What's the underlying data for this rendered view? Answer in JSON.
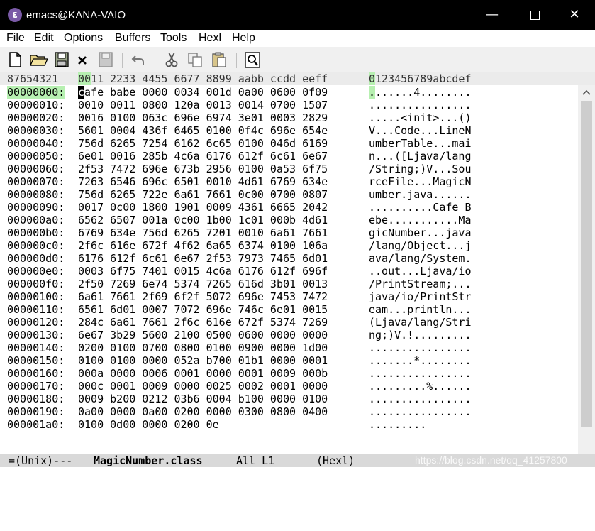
{
  "window": {
    "title": "emacs@KANA-VAIO",
    "app_icon": "emacs-icon"
  },
  "menubar": [
    "File",
    "Edit",
    "Options",
    "Buffers",
    "Tools",
    "Hexl",
    "Help"
  ],
  "toolbar": [
    "new-file-icon",
    "open-folder-icon",
    "save-disk-icon",
    "close-x-icon",
    "save-as-icon",
    "undo-icon",
    "cut-icon",
    "copy-icon",
    "paste-icon",
    "search-icon"
  ],
  "header": {
    "addr": "87654321",
    "hex_hl": "00",
    "hex_rest": "11 2233 4455 6677 8899 aabb ccdd eeff",
    "ascii_hl": "0",
    "ascii_rest": "123456789abcdef"
  },
  "cursor_row": {
    "addr": "00000000:",
    "hex_cursor": "c",
    "hex_rest": "afe babe 0000 0034 001d 0a00 0600 0f09",
    "ascii_hl": ".",
    "ascii_rest": "......4........"
  },
  "rows": [
    {
      "addr": "00000010:",
      "hex": "0010 0011 0800 120a 0013 0014 0700 1507",
      "ascii": "................"
    },
    {
      "addr": "00000020:",
      "hex": "0016 0100 063c 696e 6974 3e01 0003 2829",
      "ascii": ".....<init>...()"
    },
    {
      "addr": "00000030:",
      "hex": "5601 0004 436f 6465 0100 0f4c 696e 654e",
      "ascii": "V...Code...LineN"
    },
    {
      "addr": "00000040:",
      "hex": "756d 6265 7254 6162 6c65 0100 046d 6169",
      "ascii": "umberTable...mai"
    },
    {
      "addr": "00000050:",
      "hex": "6e01 0016 285b 4c6a 6176 612f 6c61 6e67",
      "ascii": "n...([Ljava/lang"
    },
    {
      "addr": "00000060:",
      "hex": "2f53 7472 696e 673b 2956 0100 0a53 6f75",
      "ascii": "/String;)V...Sou"
    },
    {
      "addr": "00000070:",
      "hex": "7263 6546 696c 6501 0010 4d61 6769 634e",
      "ascii": "rceFile...MagicN"
    },
    {
      "addr": "00000080:",
      "hex": "756d 6265 722e 6a61 7661 0c00 0700 0807",
      "ascii": "umber.java......"
    },
    {
      "addr": "00000090:",
      "hex": "0017 0c00 1800 1901 0009 4361 6665 2042",
      "ascii": "..........Cafe B"
    },
    {
      "addr": "000000a0:",
      "hex": "6562 6507 001a 0c00 1b00 1c01 000b 4d61",
      "ascii": "ebe...........Ma"
    },
    {
      "addr": "000000b0:",
      "hex": "6769 634e 756d 6265 7201 0010 6a61 7661",
      "ascii": "gicNumber...java"
    },
    {
      "addr": "000000c0:",
      "hex": "2f6c 616e 672f 4f62 6a65 6374 0100 106a",
      "ascii": "/lang/Object...j"
    },
    {
      "addr": "000000d0:",
      "hex": "6176 612f 6c61 6e67 2f53 7973 7465 6d01",
      "ascii": "ava/lang/System."
    },
    {
      "addr": "000000e0:",
      "hex": "0003 6f75 7401 0015 4c6a 6176 612f 696f",
      "ascii": "..out...Ljava/io"
    },
    {
      "addr": "000000f0:",
      "hex": "2f50 7269 6e74 5374 7265 616d 3b01 0013",
      "ascii": "/PrintStream;..."
    },
    {
      "addr": "00000100:",
      "hex": "6a61 7661 2f69 6f2f 5072 696e 7453 7472",
      "ascii": "java/io/PrintStr"
    },
    {
      "addr": "00000110:",
      "hex": "6561 6d01 0007 7072 696e 746c 6e01 0015",
      "ascii": "eam...println..."
    },
    {
      "addr": "00000120:",
      "hex": "284c 6a61 7661 2f6c 616e 672f 5374 7269",
      "ascii": "(Ljava/lang/Stri"
    },
    {
      "addr": "00000130:",
      "hex": "6e67 3b29 5600 2100 0500 0600 0000 0000",
      "ascii": "ng;)V.!........."
    },
    {
      "addr": "00000140:",
      "hex": "0200 0100 0700 0800 0100 0900 0000 1d00",
      "ascii": "................"
    },
    {
      "addr": "00000150:",
      "hex": "0100 0100 0000 052a b700 01b1 0000 0001",
      "ascii": ".......*........"
    },
    {
      "addr": "00000160:",
      "hex": "000a 0000 0006 0001 0000 0001 0009 000b",
      "ascii": "................"
    },
    {
      "addr": "00000170:",
      "hex": "000c 0001 0009 0000 0025 0002 0001 0000",
      "ascii": ".........%......"
    },
    {
      "addr": "00000180:",
      "hex": "0009 b200 0212 03b6 0004 b100 0000 0100",
      "ascii": "................"
    },
    {
      "addr": "00000190:",
      "hex": "0a00 0000 0a00 0200 0000 0300 0800 0400",
      "ascii": "................"
    },
    {
      "addr": "000001a0:",
      "hex": "0100 0d00 0000 0200 0e",
      "ascii": "........."
    }
  ],
  "modeline": {
    "left": "=(Unix)---",
    "buffer": "MagicNumber.class",
    "position": "All L1",
    "mode": "(Hexl)"
  },
  "watermark": "https://blog.csdn.net/qq_41257800"
}
